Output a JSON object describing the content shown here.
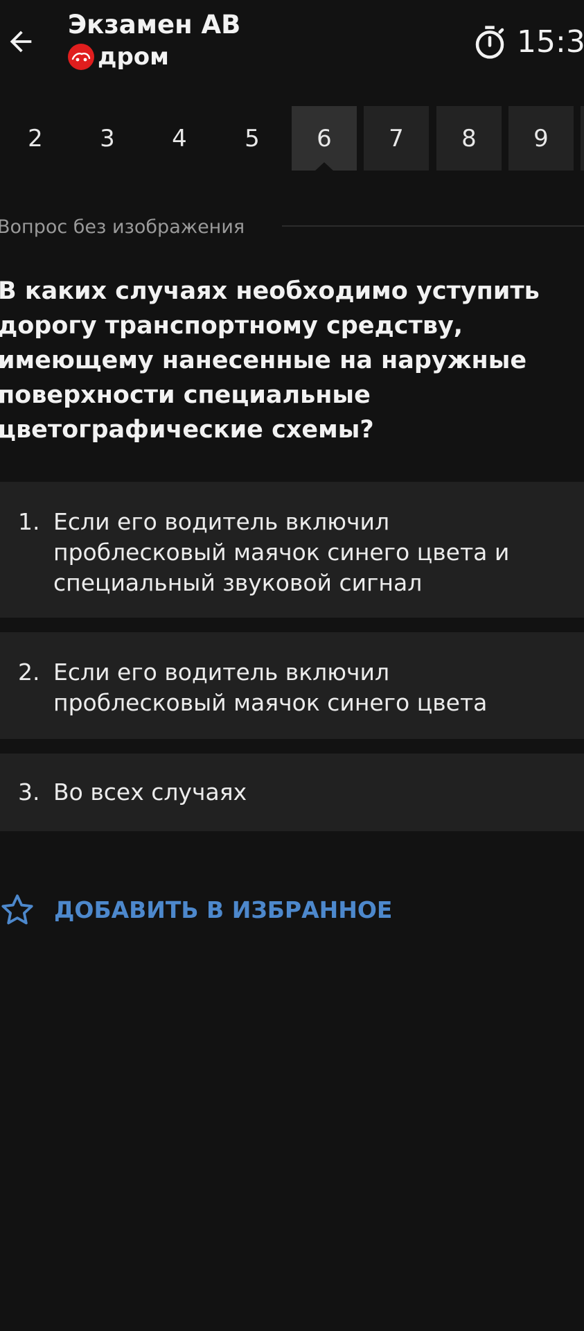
{
  "header": {
    "title": "Экзамен АВ",
    "brand": "дром",
    "timer": "15:3",
    "back_icon": "arrow-left-icon",
    "timer_icon": "stopwatch-icon",
    "brand_color": "#e01e1e"
  },
  "question_numbers": [
    "2",
    "3",
    "4",
    "5",
    "6",
    "7",
    "8",
    "9"
  ],
  "active_question": "6",
  "section_label": "Вопрос без изображения",
  "question_text": "В каких случаях необходимо уступить дорогу транспортному средству, имеющему нанесенные на наружные поверхности специальные цветографические схемы?",
  "answers": [
    {
      "number": "1.",
      "text": "Если его водитель включил проблесковый маячок синего цвета и специальный звуковой сигнал"
    },
    {
      "number": "2.",
      "text": "Если его водитель включил проблесковый маячок синего цвета"
    },
    {
      "number": "3.",
      "text": "Во всех случаях"
    }
  ],
  "favorite": {
    "label": "ДОБАВИТЬ В ИЗБРАННОЕ",
    "icon": "star-outline-icon",
    "color": "#4d88cc"
  },
  "colors": {
    "background": "#121212",
    "tile": "#232323",
    "active_tile": "#303030",
    "answer_bg": "#212121"
  }
}
